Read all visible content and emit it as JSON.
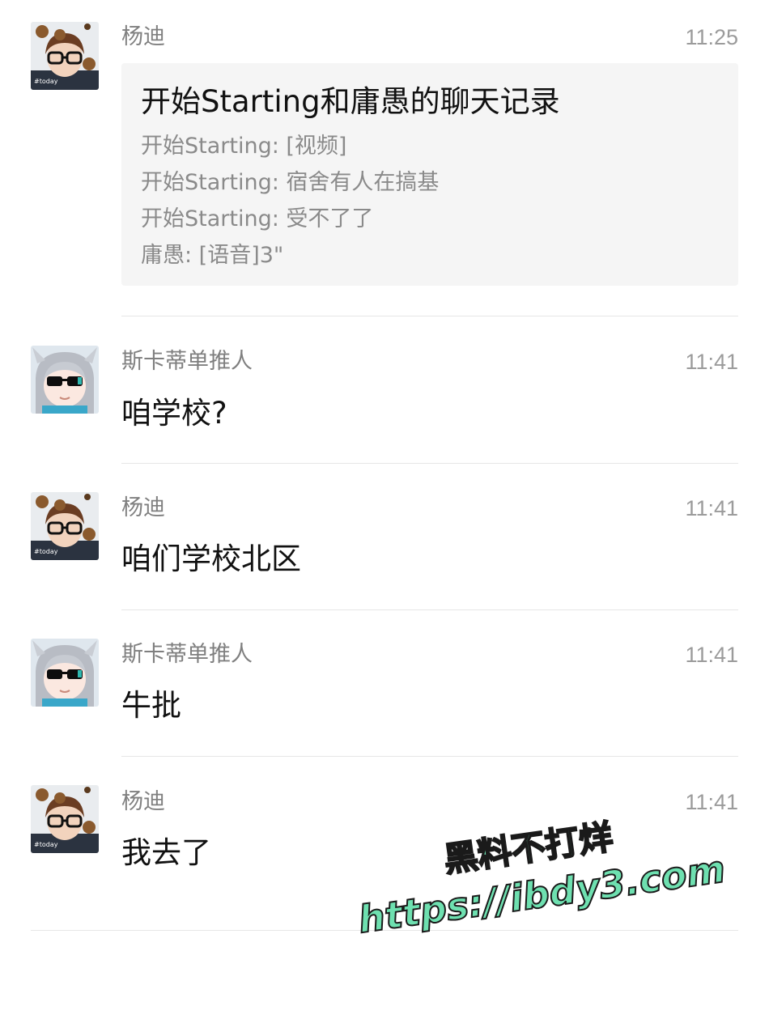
{
  "messages": [
    {
      "sender": "杨迪",
      "time": "11:25",
      "avatar": "avatar-yangdi",
      "card": {
        "title": "开始Starting和庸愚的聊天记录",
        "lines": [
          "开始Starting: [视频]",
          "开始Starting: 宿舍有人在搞基",
          "开始Starting: 受不了了",
          "庸愚: [语音]3\""
        ]
      }
    },
    {
      "sender": "斯卡蒂单推人",
      "time": "11:41",
      "avatar": "avatar-anime",
      "text": "咱学校?"
    },
    {
      "sender": "杨迪",
      "time": "11:41",
      "avatar": "avatar-yangdi",
      "text": "咱们学校北区"
    },
    {
      "sender": "斯卡蒂单推人",
      "time": "11:41",
      "avatar": "avatar-anime",
      "text": "牛批"
    },
    {
      "sender": "杨迪",
      "time": "11:41",
      "avatar": "avatar-yangdi",
      "text": "我去了"
    }
  ],
  "watermark": {
    "line1": "黑料不打烊",
    "line2": "https://ibdy3.com"
  },
  "colors": {
    "card_bg": "#f5f5f5",
    "sender": "#7f7f7f",
    "time": "#9b9b9b",
    "watermark": "#6ee0b0"
  }
}
